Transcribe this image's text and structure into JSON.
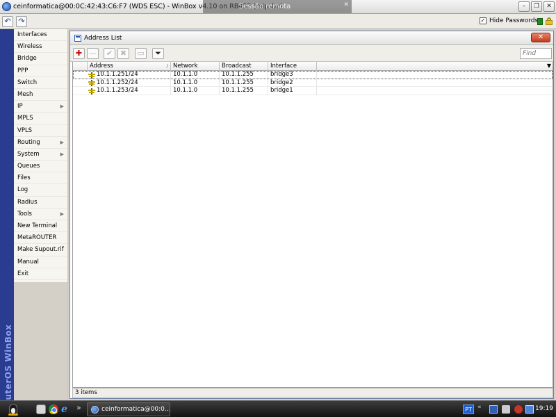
{
  "window": {
    "title": "ceinformatica@00:0C:42:43:C6:F7 (WDS ESC) - WinBox v4.10 on RB433 (mipsbe)",
    "remote_overlay": "Sessão remota",
    "remote_overlay_close": "✕",
    "minimize_glyph": "–",
    "restore_glyph": "❐",
    "close_glyph": "✕"
  },
  "toolbar": {
    "undo_glyph": "↶",
    "redo_glyph": "↷",
    "hide_passwords_label": "Hide Passwords",
    "hide_passwords_checked_glyph": "✓",
    "status_color": "#1e8a1e"
  },
  "brand": {
    "vertical_text": "RouterOS WinBox"
  },
  "sidebar": {
    "items": [
      {
        "label": "Interfaces",
        "submenu": false
      },
      {
        "label": "Wireless",
        "submenu": false
      },
      {
        "label": "Bridge",
        "submenu": false
      },
      {
        "label": "PPP",
        "submenu": false
      },
      {
        "label": "Switch",
        "submenu": false
      },
      {
        "label": "Mesh",
        "submenu": false
      },
      {
        "label": "IP",
        "submenu": true
      },
      {
        "label": "MPLS",
        "submenu": false
      },
      {
        "label": "VPLS",
        "submenu": false
      },
      {
        "label": "Routing",
        "submenu": true
      },
      {
        "label": "System",
        "submenu": true
      },
      {
        "label": "Queues",
        "submenu": false
      },
      {
        "label": "Files",
        "submenu": false
      },
      {
        "label": "Log",
        "submenu": false
      },
      {
        "label": "Radius",
        "submenu": false
      },
      {
        "label": "Tools",
        "submenu": true
      },
      {
        "label": "New Terminal",
        "submenu": false
      },
      {
        "label": "MetaROUTER",
        "submenu": false
      },
      {
        "label": "Make Supout.rif",
        "submenu": false
      },
      {
        "label": "Manual",
        "submenu": false
      },
      {
        "label": "Exit",
        "submenu": false
      }
    ],
    "submenu_glyph": "▶"
  },
  "address_list": {
    "title": "Address List",
    "close_glyph": "✕",
    "toolbar": {
      "add_glyph": "✚",
      "remove_glyph": "—",
      "enable_glyph": "✔",
      "disable_glyph": "✖",
      "comment_glyph": "▭",
      "filter_glyph": "⏷"
    },
    "find_placeholder": "Find",
    "columns": [
      {
        "label": "Address",
        "sort": "/"
      },
      {
        "label": "Network"
      },
      {
        "label": "Broadcast"
      },
      {
        "label": "Interface"
      }
    ],
    "column_menu_glyph": "▼",
    "rows": [
      {
        "address": "10.1.1.251/24",
        "network": "10.1.1.0",
        "broadcast": "10.1.1.255",
        "interface": "bridge3"
      },
      {
        "address": "10.1.1.252/24",
        "network": "10.1.1.0",
        "broadcast": "10.1.1.255",
        "interface": "bridge2"
      },
      {
        "address": "10.1.1.253/24",
        "network": "10.1.1.0",
        "broadcast": "10.1.1.255",
        "interface": "bridge1"
      }
    ],
    "item_count": "3 items"
  },
  "taskbar": {
    "ie_glyph": "e",
    "more_glyph": "»",
    "task_button_label": "ceinformatica@00:0...",
    "language": "PT",
    "tray_chevron": "«",
    "clock": "19:19"
  }
}
